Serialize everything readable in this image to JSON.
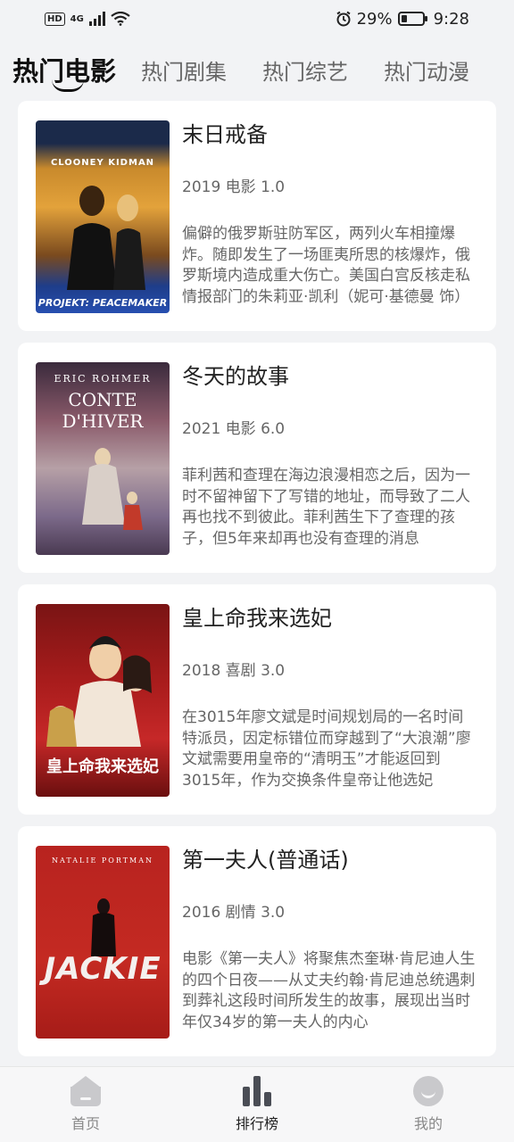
{
  "status_bar": {
    "network": "4G",
    "hd": "HD",
    "battery": "29%",
    "battery_level": 0.29,
    "time": "9:28"
  },
  "tabs": [
    {
      "label": "热门电影",
      "active": true
    },
    {
      "label": "热门剧集",
      "active": false
    },
    {
      "label": "热门综艺",
      "active": false
    },
    {
      "label": "热门动漫",
      "active": false
    }
  ],
  "movies": [
    {
      "title": "末日戒备",
      "meta": "2019 电影 1.0",
      "desc": "偏僻的俄罗斯驻防军区，两列火车相撞爆炸。随即发生了一场匪夷所思的核爆炸，俄罗斯境内造成重大伤亡。美国白宫反核走私情报部门的朱莉亚·凯利（妮可·基德曼 饰）",
      "poster_text_top": "CLOONEY    KIDMAN",
      "poster_text_bottom": "PROJEKT: PEACEMAKER"
    },
    {
      "title": "冬天的故事",
      "meta": "2021 电影 6.0",
      "desc": "菲利茜和查理在海边浪漫相恋之后，因为一时不留神留下了写错的地址，而导致了二人再也找不到彼此。菲利茜生下了查理的孩子，但5年来却再也没有查理的消息",
      "poster_text_top": "ERIC ROHMER",
      "poster_text_bottom": "CONTE D'HIVER"
    },
    {
      "title": "皇上命我来选妃",
      "meta": "2018 喜剧 3.0",
      "desc": "在3015年廖文斌是时间规划局的一名时间特派员，因定标错位而穿越到了“大浪潮”廖文斌需要用皇帝的“清明玉”才能返回到3015年，作为交换条件皇帝让他选妃",
      "poster_text_top": "",
      "poster_text_bottom": "皇上命我来选妃"
    },
    {
      "title": "第一夫人(普通话)",
      "meta": "2016 剧情 3.0",
      "desc": "电影《第一夫人》将聚焦杰奎琳·肯尼迪人生的四个日夜——从丈夫约翰·肯尼迪总统遇刺到葬礼这段时间所发生的故事，展现出当时年仅34岁的第一夫人的内心",
      "poster_text_top": "NATALIE PORTMAN",
      "poster_text_bottom": "JACKIE"
    }
  ],
  "bottom_nav": [
    {
      "label": "首页",
      "icon": "home-icon",
      "active": false
    },
    {
      "label": "排行榜",
      "icon": "ranking-icon",
      "active": true
    },
    {
      "label": "我的",
      "icon": "profile-icon",
      "active": false
    }
  ],
  "colors": {
    "background": "#f2f3f5",
    "card": "#ffffff",
    "text_primary": "#222222",
    "text_secondary": "#666666"
  }
}
